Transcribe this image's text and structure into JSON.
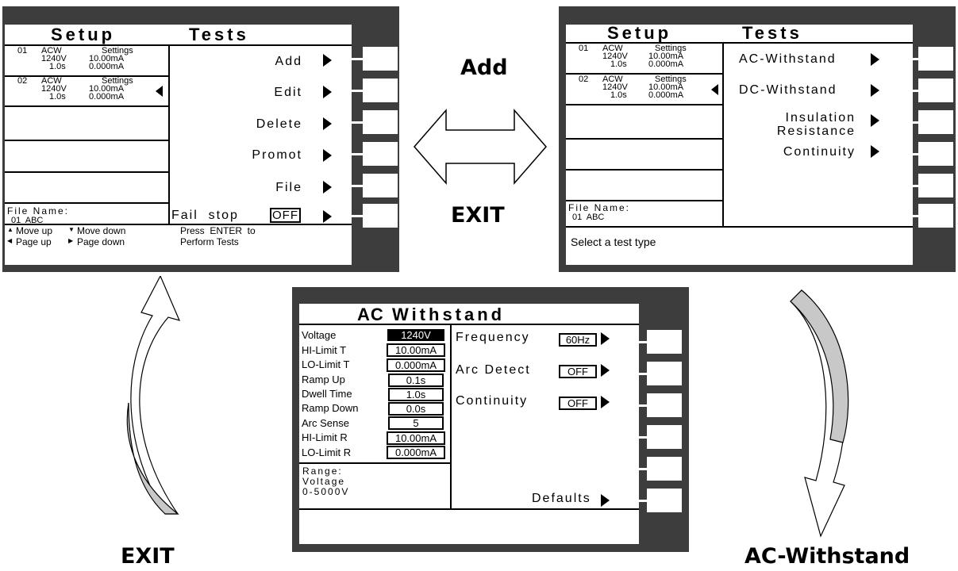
{
  "labels": {
    "add": "Add",
    "exit_top": "EXIT",
    "exit_bottom": "EXIT",
    "ac_withstand": "AC-Withstand"
  },
  "screen_setup": {
    "title_left": "Setup",
    "title_right": "Tests",
    "steps": [
      {
        "num": "01",
        "type": "ACW",
        "voltage": "1240V",
        "time": "1.0s",
        "settings": "Settings",
        "hi": "10.00mA",
        "lo": "0.000mA"
      },
      {
        "num": "02",
        "type": "ACW",
        "voltage": "1240V",
        "time": "1.0s",
        "settings": "Settings",
        "hi": "10.00mA",
        "lo": "0.000mA"
      }
    ],
    "file_label": "File Name:",
    "file_value": "01  ABC",
    "menu": [
      "Add",
      "Edit",
      "Delete",
      "Promot",
      "File",
      "Fail  stop"
    ],
    "fail_stop_value": "OFF",
    "help": {
      "up": "Move up",
      "down": "Move down",
      "pgup": "Page up",
      "pgdn": "Page down",
      "enter1": "Press  ENTER  to",
      "enter2": "Perform Tests"
    }
  },
  "screen_add": {
    "title_left": "Setup",
    "title_right": "Tests",
    "steps": [
      {
        "num": "01",
        "type": "ACW",
        "voltage": "1240V",
        "time": "1.0s",
        "settings": "Settings",
        "hi": "10.00mA",
        "lo": "0.000mA"
      },
      {
        "num": "02",
        "type": "ACW",
        "voltage": "1240V",
        "time": "1.0s",
        "settings": "Settings",
        "hi": "10.00mA",
        "lo": "0.000mA"
      }
    ],
    "file_label": "File Name:",
    "file_value": "01  ABC",
    "menu": [
      "AC-Withstand",
      "DC-Withstand",
      "Insulation",
      "Resistance",
      "Continuity"
    ],
    "status": "Select a test type"
  },
  "screen_acw": {
    "title_left": "AC",
    "title_right": "Withstand",
    "params": [
      {
        "label": "Voltage",
        "value": "1240V"
      },
      {
        "label": "HI-Limit T",
        "value": "10.00mA"
      },
      {
        "label": "LO-Limit T",
        "value": "0.000mA"
      },
      {
        "label": "Ramp Up",
        "value": "0.1s"
      },
      {
        "label": "Dwell Time",
        "value": "1.0s"
      },
      {
        "label": "Ramp Down",
        "value": "0.0s"
      },
      {
        "label": "Arc Sense",
        "value": "5"
      },
      {
        "label": "HI-Limit R",
        "value": "10.00mA"
      },
      {
        "label": "LO-Limit R",
        "value": "0.000mA"
      }
    ],
    "range_label": "Range:",
    "range_name": "Voltage",
    "range_value": "0-5000V",
    "menu": [
      {
        "label": "Frequency",
        "value": "60Hz"
      },
      {
        "label": "Arc Detect",
        "value": "OFF"
      },
      {
        "label": "Continuity",
        "value": "OFF"
      }
    ],
    "defaults": "Defaults"
  },
  "colors": {
    "bezel": "#3d3d3d",
    "arrow_fill": "#c8c8c8"
  }
}
